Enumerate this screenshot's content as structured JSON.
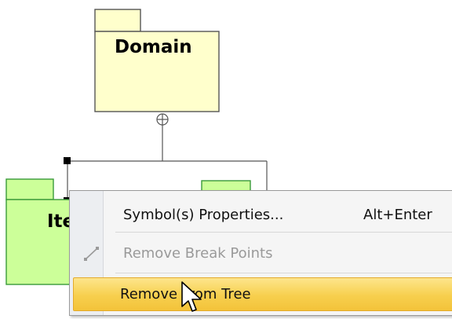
{
  "diagram": {
    "domain_package": {
      "name": "Domain"
    },
    "items_package": {
      "name_visible": "Ite"
    }
  },
  "context_menu": {
    "items": [
      {
        "label": "Symbol(s) Properties...",
        "shortcut": "Alt+Enter",
        "enabled": true,
        "icon": "none"
      },
      {
        "label": "Remove Break Points",
        "shortcut": "",
        "enabled": false,
        "icon": "break-point-line-icon"
      },
      {
        "label": "Remove From Tree",
        "shortcut": "",
        "enabled": true,
        "highlighted": true,
        "icon": "none"
      }
    ]
  },
  "colors": {
    "package_fill": "#ffffcc",
    "package_green": "#ccff99",
    "highlight": "#f7cf4d"
  }
}
